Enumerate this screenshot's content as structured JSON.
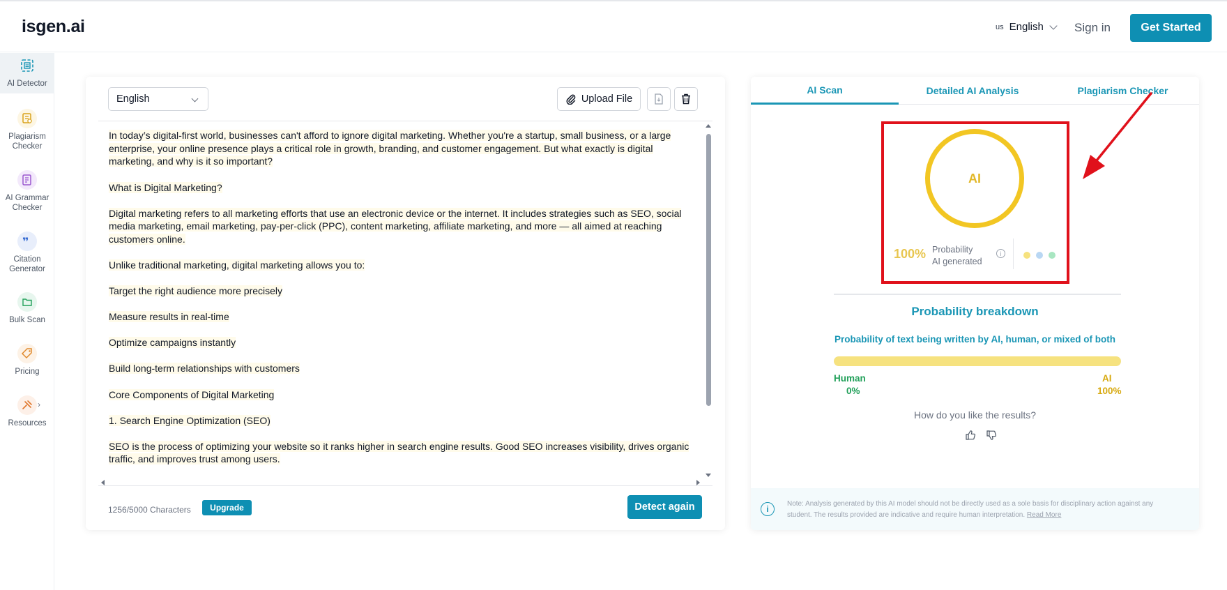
{
  "header": {
    "logo": "isgen.ai",
    "language_country": "us",
    "language": "English",
    "signin": "Sign in",
    "get_started": "Get Started"
  },
  "sidebar": {
    "items": [
      {
        "label": "AI Detector",
        "icon": "ai-detector-icon",
        "active": true
      },
      {
        "label": "Plagiarism\nChecker",
        "icon": "plagiarism-icon"
      },
      {
        "label": "AI Grammar\nChecker",
        "icon": "grammar-icon"
      },
      {
        "label": "Citation\nGenerator",
        "icon": "citation-icon"
      },
      {
        "label": "Bulk Scan",
        "icon": "folder-icon"
      },
      {
        "label": "Pricing",
        "icon": "price-tag-icon"
      },
      {
        "label": "Resources",
        "icon": "resources-icon"
      }
    ]
  },
  "editor": {
    "language": "English",
    "upload_label": "Upload File",
    "paragraphs": [
      "In today’s digital-first world, businesses can't afford to ignore digital marketing. Whether you're a startup, small business, or a large enterprise, your online presence plays a critical role in growth, branding, and customer engagement. But what exactly is digital marketing, and why is it so important?",
      "What is Digital Marketing?",
      "Digital marketing refers to all marketing efforts that use an electronic device or the internet. It includes strategies such as SEO, social media marketing, email marketing, pay-per-click (PPC), content marketing, affiliate marketing, and more — all aimed at reaching customers online.",
      "Unlike traditional marketing, digital marketing allows you to:",
      "Target the right audience more precisely",
      "Measure results in real-time",
      "Optimize campaigns instantly",
      "Build long-term relationships with customers",
      "Core Components of Digital Marketing",
      "1. Search Engine Optimization (SEO)",
      "SEO is the process of optimizing your website so it ranks higher in search engine results. Good SEO increases visibility, drives organic traffic, and improves trust among users."
    ],
    "char_count": "1256/5000 Characters",
    "upgrade_label": "Upgrade",
    "detect_label": "Detect again"
  },
  "results": {
    "tabs": [
      "AI Scan",
      "Detailed AI Analysis",
      "Plagiarism Checker"
    ],
    "active_tab": 0,
    "ring_label": "AI",
    "probability_pct": "100%",
    "probability_label_1": "Probability",
    "probability_label_2": "AI generated",
    "legend_colors": [
      "#f6e27f",
      "#b9d7f3",
      "#a8e6c1"
    ],
    "breakdown_title": "Probability breakdown",
    "breakdown_subtitle": "Probability of text being written by AI, human, or mixed of both",
    "ai_share": 1.0,
    "human_label": "Human",
    "human_value": "0%",
    "ai_label": "AI",
    "ai_value": "100%",
    "feedback_question": "How do you like the results?",
    "note_text": "Note: Analysis generated by this AI model should not be directly used as a sole basis for disciplinary action against any student. The results provided are indicative and require human interpretation.",
    "note_link": "Read More"
  },
  "colors": {
    "brand": "#0e8fb3",
    "ai_yellow": "#f2c623",
    "human_green": "#22a05a",
    "annotation_red": "#e0111b"
  }
}
